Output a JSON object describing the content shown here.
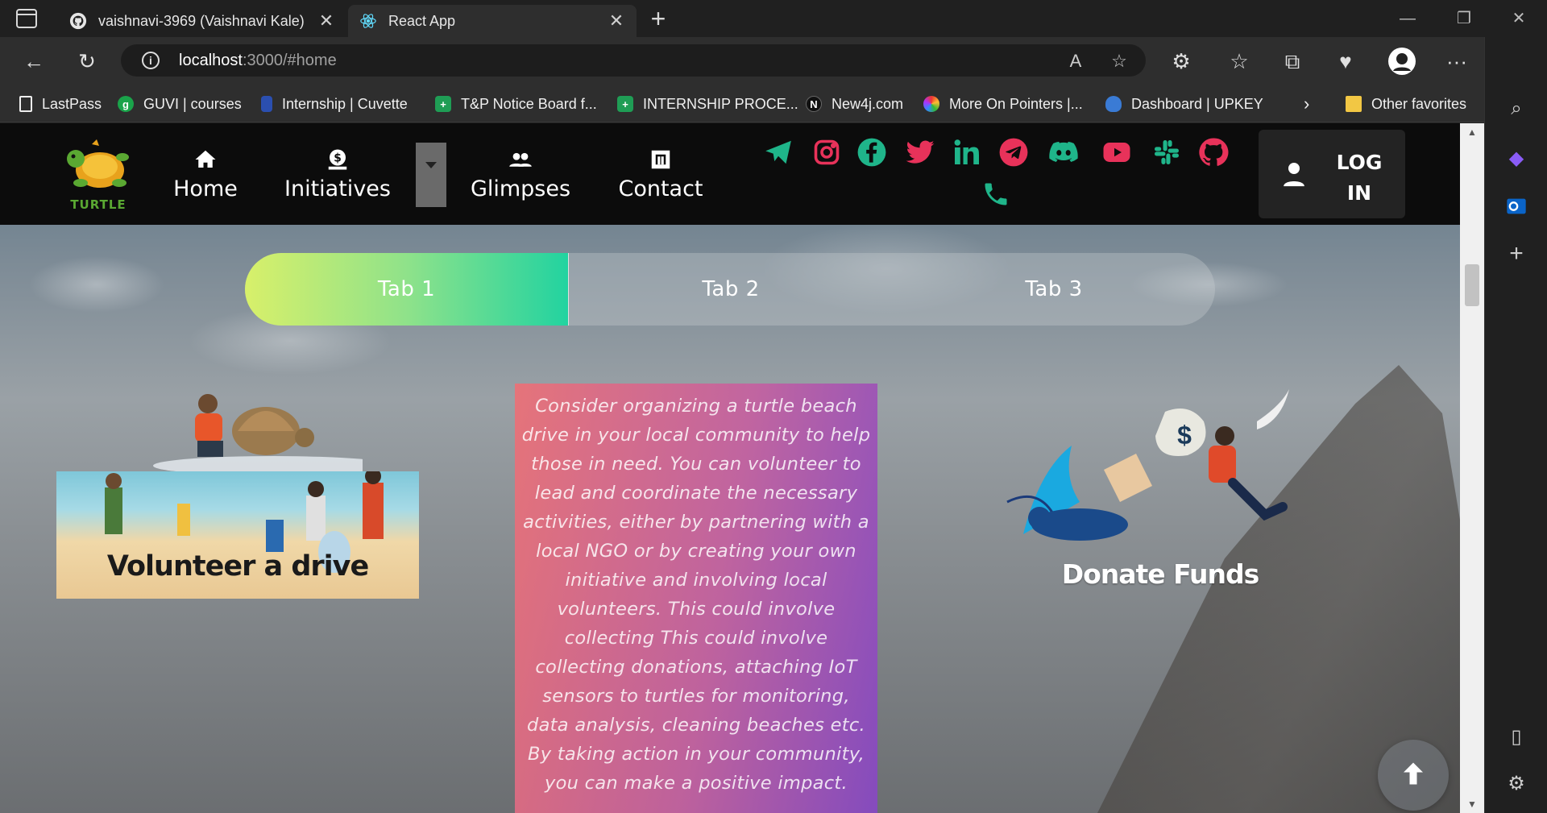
{
  "browser": {
    "tabs": [
      {
        "title": "vaishnavi-3969 (Vaishnavi Kale)",
        "favicon": "github-icon",
        "active": false
      },
      {
        "title": "React App",
        "favicon": "react-icon",
        "active": true
      }
    ],
    "address": {
      "host": "localhost",
      "rest": ":3000/#home"
    },
    "bookmarks": [
      {
        "label": "LastPass",
        "icon": "page-icon"
      },
      {
        "label": "GUVI | courses",
        "icon": "guvi-icon"
      },
      {
        "label": "Internship | Cuvette",
        "icon": "cuvette-icon"
      },
      {
        "label": "T&P Notice Board f...",
        "icon": "green-plus-icon"
      },
      {
        "label": "INTERNSHIP PROCE...",
        "icon": "green-plus-icon"
      },
      {
        "label": "New4j.com",
        "icon": "new4j-icon"
      },
      {
        "label": "More On Pointers |...",
        "icon": "pinwheel-icon"
      },
      {
        "label": "Dashboard | UPKEY",
        "icon": "upkey-icon"
      }
    ],
    "other_favorites": "Other favorites"
  },
  "site": {
    "logo_text": "TURTLE",
    "nav": {
      "home": "Home",
      "initiatives": "Initiatives",
      "glimpses": "Glimpses",
      "contact": "Contact"
    },
    "social": [
      {
        "name": "telegram-icon",
        "color": "#1fb58a"
      },
      {
        "name": "instagram-icon",
        "color": "#e8325a"
      },
      {
        "name": "facebook-icon",
        "color": "#1fb58a"
      },
      {
        "name": "twitter-icon",
        "color": "#e8325a"
      },
      {
        "name": "linkedin-icon",
        "color": "#1fb58a"
      },
      {
        "name": "telegram-circle-icon",
        "color": "#e8325a"
      },
      {
        "name": "discord-icon",
        "color": "#1fb58a"
      },
      {
        "name": "youtube-icon",
        "color": "#e8325a"
      },
      {
        "name": "slack-icon",
        "color": "#1fb58a"
      },
      {
        "name": "github-icon",
        "color": "#e8325a"
      },
      {
        "name": "phone-icon",
        "color": "#1fb58a"
      }
    ],
    "login_line1": "LOG",
    "login_line2": "IN"
  },
  "tabs": {
    "tab1": "Tab 1",
    "tab2": "Tab 2",
    "tab3": "Tab 3",
    "active": "Tab 1"
  },
  "cards": {
    "left_title": "Volunteer a drive",
    "description": "Consider organizing a turtle beach drive in your local community to help those in need. You can volunteer to lead and coordinate the necessary activities, either by partnering with a local NGO or by creating your own initiative and involving local volunteers. This could involve collecting This could involve collecting donations, attaching IoT sensors to turtles for monitoring, data analysis, cleaning beaches etc. By taking action in your community, you can make a positive impact.",
    "right_title": "Donate Funds"
  },
  "colors": {
    "accent_green": "#1fb58a",
    "accent_pink": "#e8325a",
    "tab_gradient_start": "#d8f06a",
    "tab_gradient_end": "#22d3a0"
  }
}
